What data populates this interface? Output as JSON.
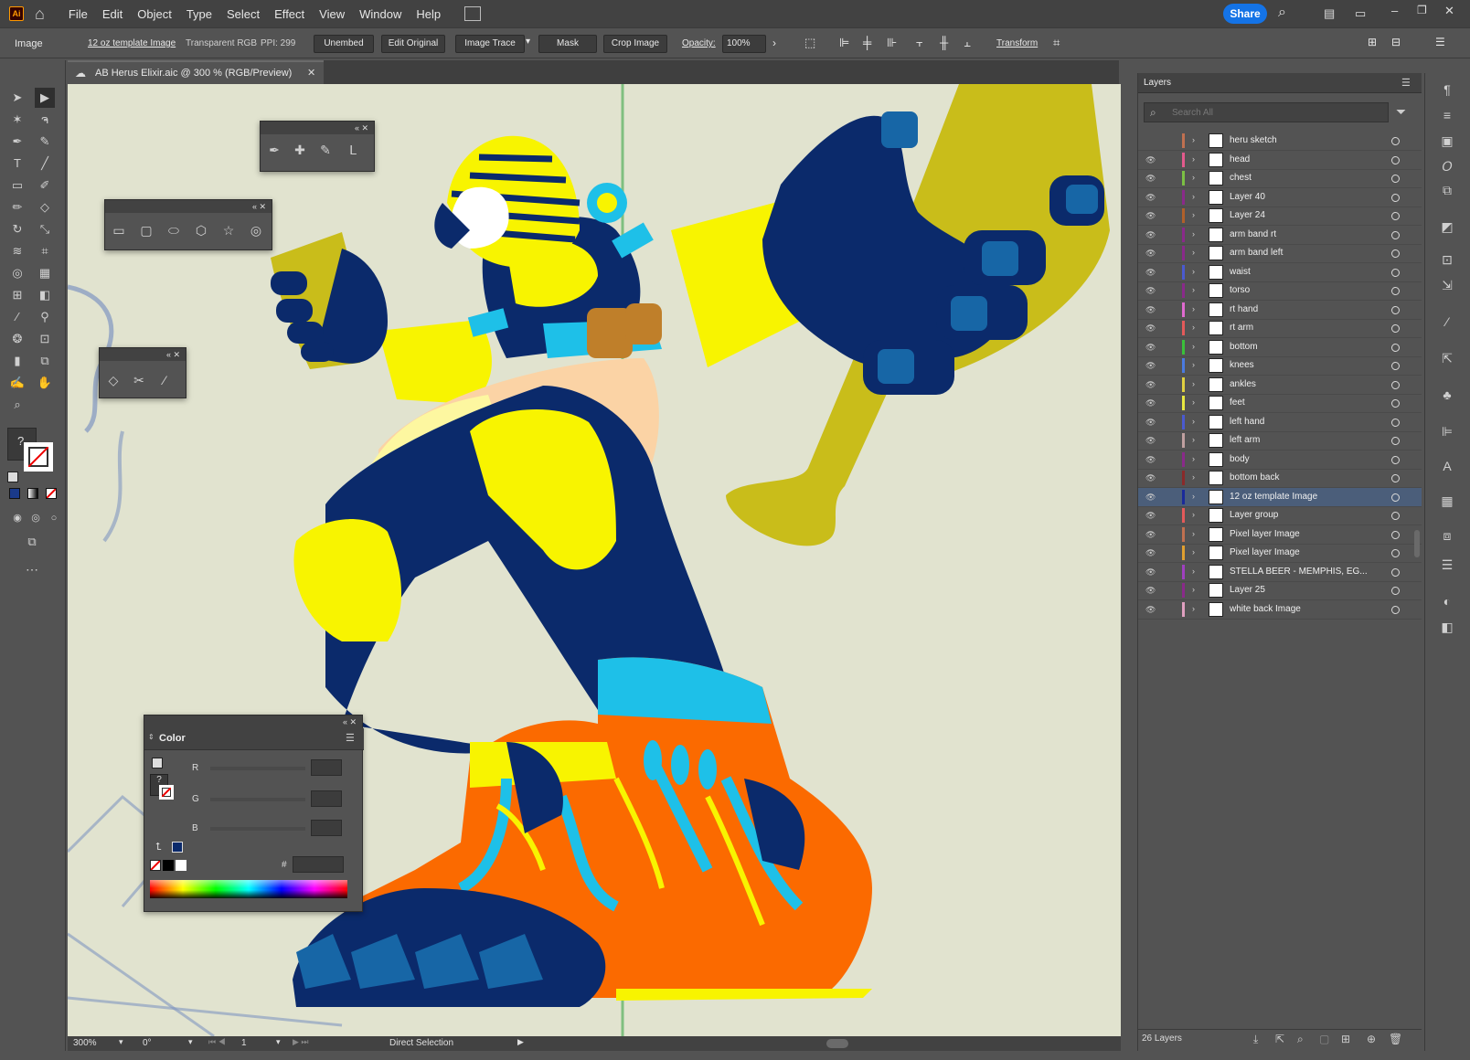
{
  "menubar": {
    "logo": "Ai",
    "items": [
      "File",
      "Edit",
      "Object",
      "Type",
      "Select",
      "Effect",
      "View",
      "Window",
      "Help"
    ],
    "share_label": "Share"
  },
  "control_bar": {
    "selection_type": "Image",
    "object_name": "12 oz template Image",
    "color_mode": "Transparent RGB",
    "ppi": "PPI: 299",
    "unembed": "Unembed",
    "edit_original": "Edit Original",
    "image_trace": "Image Trace",
    "mask": "Mask",
    "crop_image": "Crop Image",
    "opacity_label": "Opacity:",
    "opacity_value": "100%",
    "transform": "Transform"
  },
  "document": {
    "tab_title": "AB Herus Elixir.aic @ 300 % (RGB/Preview)"
  },
  "status_bar": {
    "zoom": "300%",
    "rotation": "0°",
    "artboard": "1",
    "tool": "Direct Selection"
  },
  "layers_panel": {
    "title": "Layers",
    "search_placeholder": "Search All",
    "count_label": "26 Layers",
    "layers": [
      {
        "name": "heru sketch",
        "color": "#c07050",
        "visible": false,
        "selected": false
      },
      {
        "name": "head",
        "color": "#e35a8c",
        "visible": true,
        "selected": false
      },
      {
        "name": "chest",
        "color": "#7bc043",
        "visible": true,
        "selected": false
      },
      {
        "name": "Layer 40",
        "color": "#8a2a8a",
        "visible": true,
        "selected": false
      },
      {
        "name": "Layer 24",
        "color": "#b0602a",
        "visible": true,
        "selected": false
      },
      {
        "name": "arm band rt",
        "color": "#8a2a8a",
        "visible": true,
        "selected": false
      },
      {
        "name": "arm band left",
        "color": "#8a2a8a",
        "visible": true,
        "selected": false
      },
      {
        "name": "waist",
        "color": "#4a5ad0",
        "visible": true,
        "selected": false
      },
      {
        "name": "torso",
        "color": "#8a2a8a",
        "visible": true,
        "selected": false
      },
      {
        "name": "rt hand",
        "color": "#e06ad0",
        "visible": true,
        "selected": false
      },
      {
        "name": "rt arm",
        "color": "#e35a5a",
        "visible": true,
        "selected": false
      },
      {
        "name": "bottom",
        "color": "#3ac03a",
        "visible": true,
        "selected": false
      },
      {
        "name": "knees",
        "color": "#4a7ae0",
        "visible": true,
        "selected": false
      },
      {
        "name": "ankles",
        "color": "#e0d040",
        "visible": true,
        "selected": false
      },
      {
        "name": "feet",
        "color": "#e8e840",
        "visible": true,
        "selected": false
      },
      {
        "name": "left hand",
        "color": "#4a5ad0",
        "visible": true,
        "selected": false
      },
      {
        "name": "left arm",
        "color": "#c0a0a0",
        "visible": true,
        "selected": false
      },
      {
        "name": "body",
        "color": "#8a2a8a",
        "visible": true,
        "selected": false
      },
      {
        "name": "bottom back",
        "color": "#8a2a2a",
        "visible": true,
        "selected": false
      },
      {
        "name": "12 oz template Image",
        "color": "#1a2a9a",
        "visible": true,
        "selected": true
      },
      {
        "name": "Layer group",
        "color": "#e35a5a",
        "visible": true,
        "selected": false
      },
      {
        "name": "Pixel layer Image",
        "color": "#c07050",
        "visible": true,
        "selected": false
      },
      {
        "name": "Pixel layer Image",
        "color": "#e0a030",
        "visible": true,
        "selected": false
      },
      {
        "name": "STELLA BEER - MEMPHIS, EG...",
        "color": "#a040c0",
        "visible": true,
        "selected": false
      },
      {
        "name": "Layer 25",
        "color": "#8a2a8a",
        "visible": true,
        "selected": false
      },
      {
        "name": "white back Image",
        "color": "#e0a0c0",
        "visible": true,
        "selected": false
      }
    ]
  },
  "color_panel": {
    "title": "Color",
    "r_label": "R",
    "g_label": "G",
    "b_label": "B",
    "hex_label": "#"
  },
  "tool_panel": {
    "unknown_fill": "?"
  },
  "colors": {
    "canvas_bg": "#e1e3cf",
    "navy": "#0b2a6b",
    "yellow": "#f8f400",
    "olive": "#c9bd1a",
    "orange": "#fb6a00",
    "cyan": "#1ec0e8",
    "accent": "#1473e6"
  }
}
